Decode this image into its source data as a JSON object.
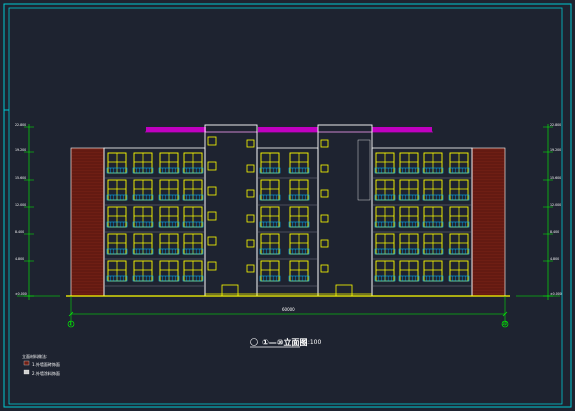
{
  "drawing": {
    "title": "①—⑩立面图",
    "scale": "1:100",
    "overall_dim": "60000",
    "axis_left": "1",
    "axis_right": "10",
    "legend_title": "立面材料做法:",
    "legend_items": [
      "1.外墙面砖饰面",
      "2.外墙涂料饰面"
    ],
    "level_marks_left": [
      "22.800",
      "19.200",
      "15.600",
      "12.000",
      "8.400",
      "4.800",
      "±0.000"
    ],
    "level_marks_right": [
      "22.800",
      "19.200",
      "15.600",
      "12.000",
      "8.400",
      "4.800",
      "±0.000"
    ],
    "floors": 5,
    "colors": {
      "background": "#1e2330",
      "frame": "#00c8d2",
      "window": "#ffff00",
      "railing": "#00b4ff",
      "brick": "#6e1e14",
      "roof": "#c000c0",
      "dim_line": "#00ff00",
      "outline": "#ffffff",
      "ground": "#ffff00"
    }
  }
}
